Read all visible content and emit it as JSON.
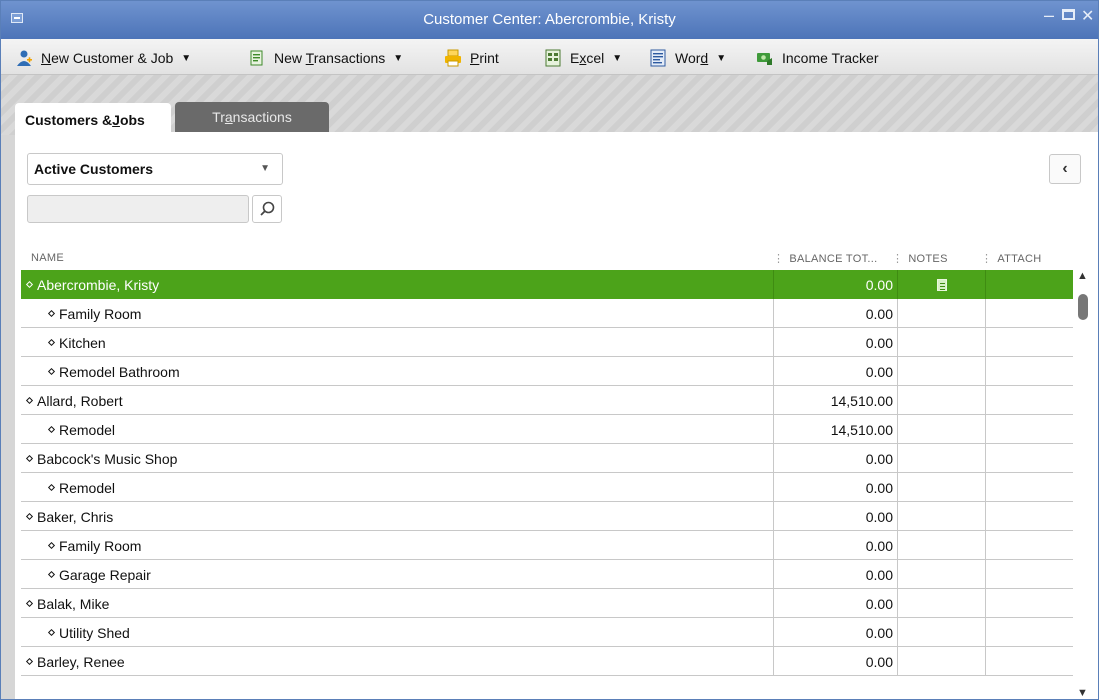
{
  "window": {
    "title": "Customer Center: Abercrombie, Kristy"
  },
  "toolbar": {
    "items": [
      {
        "label_pre": "",
        "label_u": "N",
        "label_post": "ew Customer & Job",
        "icon": "new-customer-icon",
        "dropdown": true
      },
      {
        "label_pre": "New ",
        "label_u": "T",
        "label_post": "ransactions",
        "icon": "new-transactions-icon",
        "dropdown": true
      },
      {
        "label_pre": "",
        "label_u": "P",
        "label_post": "rint",
        "icon": "printer-icon",
        "dropdown": false
      },
      {
        "label_pre": "E",
        "label_u": "x",
        "label_post": "cel",
        "icon": "excel-icon",
        "dropdown": true
      },
      {
        "label_pre": "Wor",
        "label_u": "d",
        "label_post": "",
        "icon": "word-icon",
        "dropdown": true
      },
      {
        "label_pre": "Income Tracker",
        "label_u": "",
        "label_post": "",
        "icon": "income-tracker-icon",
        "dropdown": false
      }
    ]
  },
  "tabs": {
    "active_pre": "Customers & ",
    "active_u": "J",
    "active_post": "obs",
    "inactive_pre": "Tr",
    "inactive_u": "a",
    "inactive_post": "nsactions"
  },
  "filter": {
    "selected": "Active Customers"
  },
  "collapse_button": "‹",
  "search": {
    "value": "",
    "placeholder": ""
  },
  "columns": {
    "name": "NAME",
    "balance": "BALANCE TOT...",
    "notes": "NOTES",
    "attach": "ATTACH"
  },
  "rows": [
    {
      "name": "Abercrombie, Kristy",
      "level": 0,
      "balance": "0.00",
      "has_note": true,
      "selected": true
    },
    {
      "name": "Family Room",
      "level": 1,
      "balance": "0.00",
      "has_note": false,
      "selected": false
    },
    {
      "name": "Kitchen",
      "level": 1,
      "balance": "0.00",
      "has_note": false,
      "selected": false
    },
    {
      "name": "Remodel Bathroom",
      "level": 1,
      "balance": "0.00",
      "has_note": false,
      "selected": false
    },
    {
      "name": "Allard, Robert",
      "level": 0,
      "balance": "14,510.00",
      "has_note": false,
      "selected": false
    },
    {
      "name": "Remodel",
      "level": 1,
      "balance": "14,510.00",
      "has_note": false,
      "selected": false
    },
    {
      "name": "Babcock's Music Shop",
      "level": 0,
      "balance": "0.00",
      "has_note": false,
      "selected": false
    },
    {
      "name": "Remodel",
      "level": 1,
      "balance": "0.00",
      "has_note": false,
      "selected": false
    },
    {
      "name": "Baker, Chris",
      "level": 0,
      "balance": "0.00",
      "has_note": false,
      "selected": false
    },
    {
      "name": "Family Room",
      "level": 1,
      "balance": "0.00",
      "has_note": false,
      "selected": false
    },
    {
      "name": "Garage Repair",
      "level": 1,
      "balance": "0.00",
      "has_note": false,
      "selected": false
    },
    {
      "name": "Balak, Mike",
      "level": 0,
      "balance": "0.00",
      "has_note": false,
      "selected": false
    },
    {
      "name": "Utility Shed",
      "level": 1,
      "balance": "0.00",
      "has_note": false,
      "selected": false
    },
    {
      "name": "Barley, Renee",
      "level": 0,
      "balance": "0.00",
      "has_note": false,
      "selected": false
    }
  ],
  "colors": {
    "selection": "#4ca31a",
    "titlebar": "#5a7fc0"
  }
}
